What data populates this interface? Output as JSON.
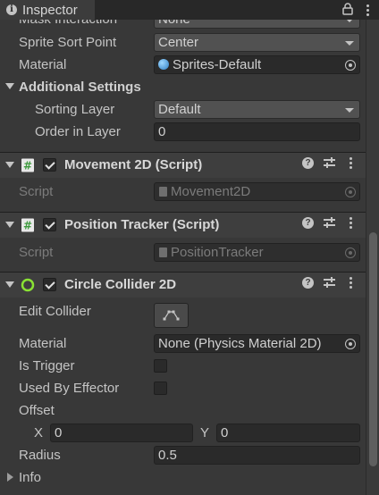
{
  "window": {
    "tab_title": "Inspector",
    "tab_icons": [
      "info-icon",
      "lock-icon",
      "kebab-menu-icon"
    ]
  },
  "sprite_renderer": {
    "mask_interaction_label": "Mask Interaction",
    "mask_interaction_value": "None",
    "sprite_sort_point_label": "Sprite Sort Point",
    "sprite_sort_point_value": "Center",
    "material_label": "Material",
    "material_value": "Sprites-Default",
    "additional_settings_label": "Additional Settings",
    "sorting_layer_label": "Sorting Layer",
    "sorting_layer_value": "Default",
    "order_in_layer_label": "Order in Layer",
    "order_in_layer_value": "0"
  },
  "movement": {
    "title": "Movement 2D (Script)",
    "enabled": true,
    "script_label": "Script",
    "script_value": "Movement2D"
  },
  "position_tracker": {
    "title": "Position Tracker (Script)",
    "enabled": true,
    "script_label": "Script",
    "script_value": "PositionTracker"
  },
  "circle_collider": {
    "title": "Circle Collider 2D",
    "enabled": true,
    "edit_collider_label": "Edit Collider",
    "material_label": "Material",
    "material_value": "None (Physics Material 2D)",
    "is_trigger_label": "Is Trigger",
    "is_trigger": false,
    "used_by_effector_label": "Used By Effector",
    "used_by_effector": false,
    "offset_label": "Offset",
    "offset_x_label": "X",
    "offset_x": "0",
    "offset_y_label": "Y",
    "offset_y": "0",
    "radius_label": "Radius",
    "radius_value": "0.5",
    "info_label": "Info"
  },
  "colors": {
    "background": "#383838",
    "header": "#3e3e3e",
    "field": "#2a2a2a",
    "dropdown": "#515151",
    "collider_icon": "#8ae234"
  }
}
